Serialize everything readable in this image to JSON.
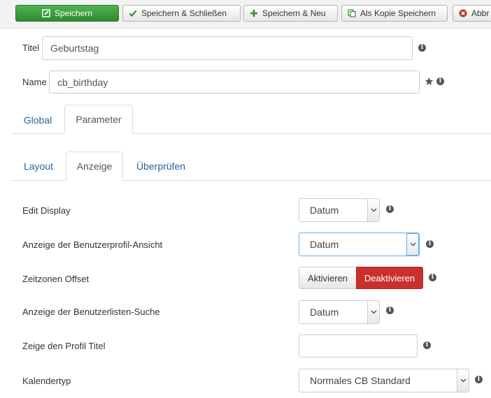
{
  "toolbar": {
    "save_label": "Speichern",
    "save_close_label": "Speichern & Schließen",
    "save_new_label": "Speichern & Neu",
    "save_copy_label": "Als Kopie Speichern",
    "cancel_label": "Abbr"
  },
  "form": {
    "title_label": "Titel",
    "title_value": "Geburtstag",
    "name_label": "Name",
    "name_value": "cb_birthday"
  },
  "main_tabs": [
    {
      "label": "Global"
    },
    {
      "label": "Parameter"
    }
  ],
  "sub_tabs": [
    {
      "label": "Layout"
    },
    {
      "label": "Anzeige"
    },
    {
      "label": "Überprüfen"
    }
  ],
  "params": {
    "edit_display": {
      "label": "Edit Display",
      "value": "Datum"
    },
    "profile_view": {
      "label": "Anzeige der Benutzerprofil-Ansicht",
      "value": "Datum"
    },
    "timezone": {
      "label": "Zeitzonen Offset",
      "on_label": "Aktivieren",
      "off_label": "Deaktivieren"
    },
    "userlist_search": {
      "label": "Anzeige der Benutzerlisten-Suche",
      "value": "Datum"
    },
    "profile_title": {
      "label": "Zeige den Profil Titel",
      "value": ""
    },
    "calendar_type": {
      "label": "Kalendertyp",
      "value": "Normales CB Standard"
    }
  },
  "colors": {
    "save_green": "#3a9a3a",
    "deactivate_red": "#c9302c",
    "link_blue": "#2a6496"
  }
}
